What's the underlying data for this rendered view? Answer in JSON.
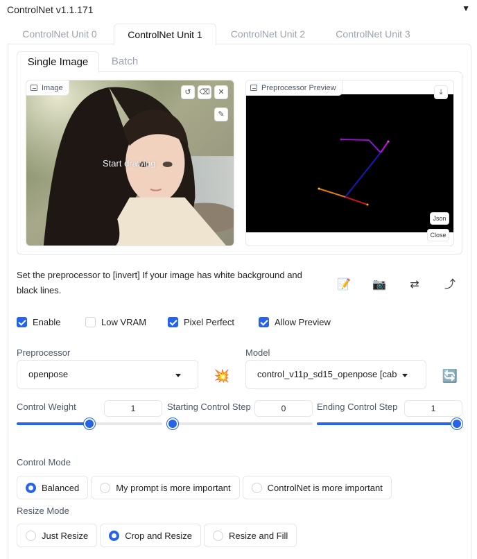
{
  "header": {
    "title": "ControlNet v1.1.171",
    "collapse_icon": "triangle-down-icon"
  },
  "unit_tabs": [
    {
      "label": "ControlNet Unit 0",
      "active": false
    },
    {
      "label": "ControlNet Unit 1",
      "active": true
    },
    {
      "label": "ControlNet Unit 2",
      "active": false
    },
    {
      "label": "ControlNet Unit 3",
      "active": false
    }
  ],
  "image_tabs": [
    {
      "label": "Single Image",
      "active": true
    },
    {
      "label": "Batch",
      "active": false
    }
  ],
  "image_box": {
    "label": "Image",
    "overlay_text": "Start drawing"
  },
  "preview_box": {
    "label": "Preprocessor Preview",
    "json_label": "Json",
    "close_label": "Close"
  },
  "hint_text": "Set the preprocessor to [invert] If your image has white background and black lines.",
  "checkboxes": [
    {
      "label": "Enable",
      "checked": true
    },
    {
      "label": "Low VRAM",
      "checked": false
    },
    {
      "label": "Pixel Perfect",
      "checked": true
    },
    {
      "label": "Allow Preview",
      "checked": true
    }
  ],
  "preprocessor": {
    "label": "Preprocessor",
    "value": "openpose"
  },
  "model": {
    "label": "Model",
    "value": "control_v11p_sd15_openpose [cab"
  },
  "sliders": {
    "weight": {
      "label": "Control Weight",
      "value": "1",
      "fraction": 0.5
    },
    "start": {
      "label": "Starting Control Step",
      "value": "0",
      "fraction": 0.0
    },
    "end": {
      "label": "Ending Control Step",
      "value": "1",
      "fraction": 1.0
    }
  },
  "control_mode": {
    "label": "Control Mode",
    "options": [
      "Balanced",
      "My prompt is more important",
      "ControlNet is more important"
    ],
    "selected": "Balanced"
  },
  "resize_mode": {
    "label": "Resize Mode",
    "options": [
      "Just Resize",
      "Crop and Resize",
      "Resize and Fill"
    ],
    "selected": "Crop and Resize"
  },
  "colors": {
    "accent": "#2563eb",
    "border": "#e5e7eb",
    "muted_text": "#9ca3af"
  }
}
